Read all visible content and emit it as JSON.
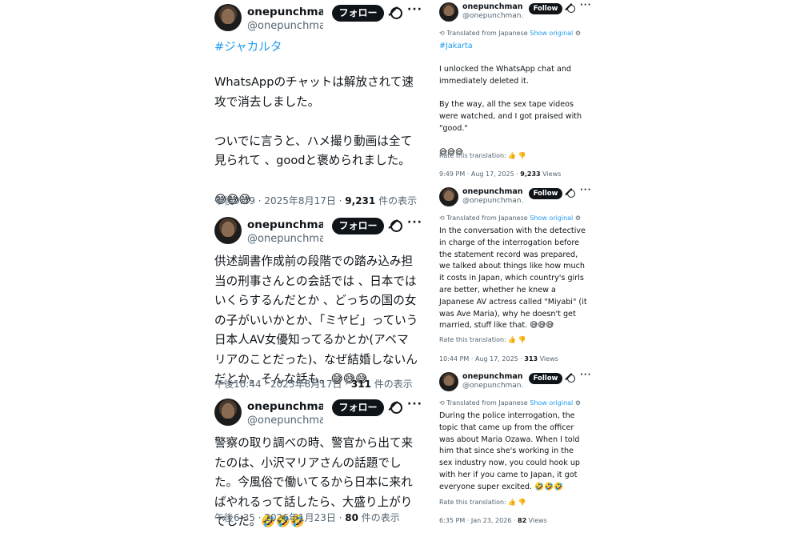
{
  "left_posts": [
    {
      "username": "onepunchmanr...",
      "handle": "@onepunchma...",
      "follow_label": "フォロー",
      "hashtag": "#ジャカルタ",
      "text": "WhatsAppのチャットは解放されて速攻で消去しました。\n\nついでに言うと、ハメ撮り動画は全て見られて 、goodと褒められました。\n\n😅😅😅",
      "time": "午後9:49 · 2025年8月17日 · ",
      "views": "9,231",
      "views_suffix": " 件の表示"
    },
    {
      "username": "onepunchmanr...",
      "handle": "@onepunchman...",
      "follow_label": "フォロー",
      "text": "供述調書作成前の段階での踏み込み担当の刑事さんとの会話では 、日本ではいくらするんだとか 、どっちの国の女の子がいいかとか、「ミヤビ」っていう日本人AV女優知ってるかとか(アベマリアのことだった)、なぜ結婚しないんだとか。そんな話も。😅😅😅",
      "time": "午後10:44 · 2025年8月17日 · ",
      "views": "311",
      "views_suffix": " 件の表示"
    },
    {
      "username": "onepunchmanr...",
      "handle": "@onepunchma...",
      "follow_label": "フォロー",
      "text": "警察の取り調べの時、警官から出て来たのは、小沢マリアさんの話題でした。今風俗で働いてるから日本に来ればやれるって話したら、大盛り上がりでした。🤣🤣🤣",
      "time": "午後6:35 · 2026年1月23日 · ",
      "views": "80",
      "views_suffix": " 件の表示"
    }
  ],
  "right_posts": [
    {
      "username": "onepunchmanr...",
      "handle": "@onepunchman...",
      "follow_label": "Follow",
      "translated_label": "Translated from Japanese",
      "show_original": "Show original",
      "hashtag": "#Jakarta",
      "text": "I unlocked the WhatsApp chat and immediately deleted it.\n\nBy the way, all the sex tape videos were watched, and I got praised with \"good.\"\n\n😅😅😅",
      "rate_label": "Rate this translation:",
      "time": "9:49 PM · Aug 17, 2025 · ",
      "views": "9,233",
      "views_suffix": " Views"
    },
    {
      "username": "onepunchmanr...",
      "handle": "@onepunchman...",
      "follow_label": "Follow",
      "translated_label": "Translated from Japanese",
      "show_original": "Show original",
      "text": "In the conversation with the detective in charge of the interrogation before the statement record was prepared, we talked about things like how much it costs in Japan, which country's girls are better, whether he knew a Japanese AV actress called \"Miyabi\" (it was Ave Maria), why he doesn't get married, stuff like that. 😅😅😅",
      "rate_label": "Rate this translation:",
      "time": "10:44 PM · Aug 17, 2025 · ",
      "views": "313",
      "views_suffix": " Views"
    },
    {
      "username": "onepunchmanr...",
      "handle": "@onepunchman...",
      "follow_label": "Follow",
      "translated_label": "Translated from Japanese",
      "show_original": "Show original",
      "text": "During the police interrogation, the topic that came up from the officer was about Maria Ozawa. When I told him that since she's working in the sex industry now, you could hook up with her if you came to Japan, it got everyone super excited. 🤣🤣🤣",
      "rate_label": "Rate this translation:",
      "time": "6:35 PM · Jan 23, 2026 · ",
      "views": "82",
      "views_suffix": " Views"
    }
  ]
}
